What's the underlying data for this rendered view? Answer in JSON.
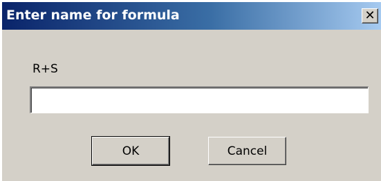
{
  "dialog": {
    "title": "Enter name for formula",
    "close_glyph": "✕",
    "close_icon": "close-icon",
    "prompt": "R+S",
    "name_value": "",
    "ok_label": "OK",
    "cancel_label": "Cancel"
  },
  "colors": {
    "face": "#d4d0c8",
    "title_start": "#0a246a",
    "title_end": "#a6caf0"
  }
}
